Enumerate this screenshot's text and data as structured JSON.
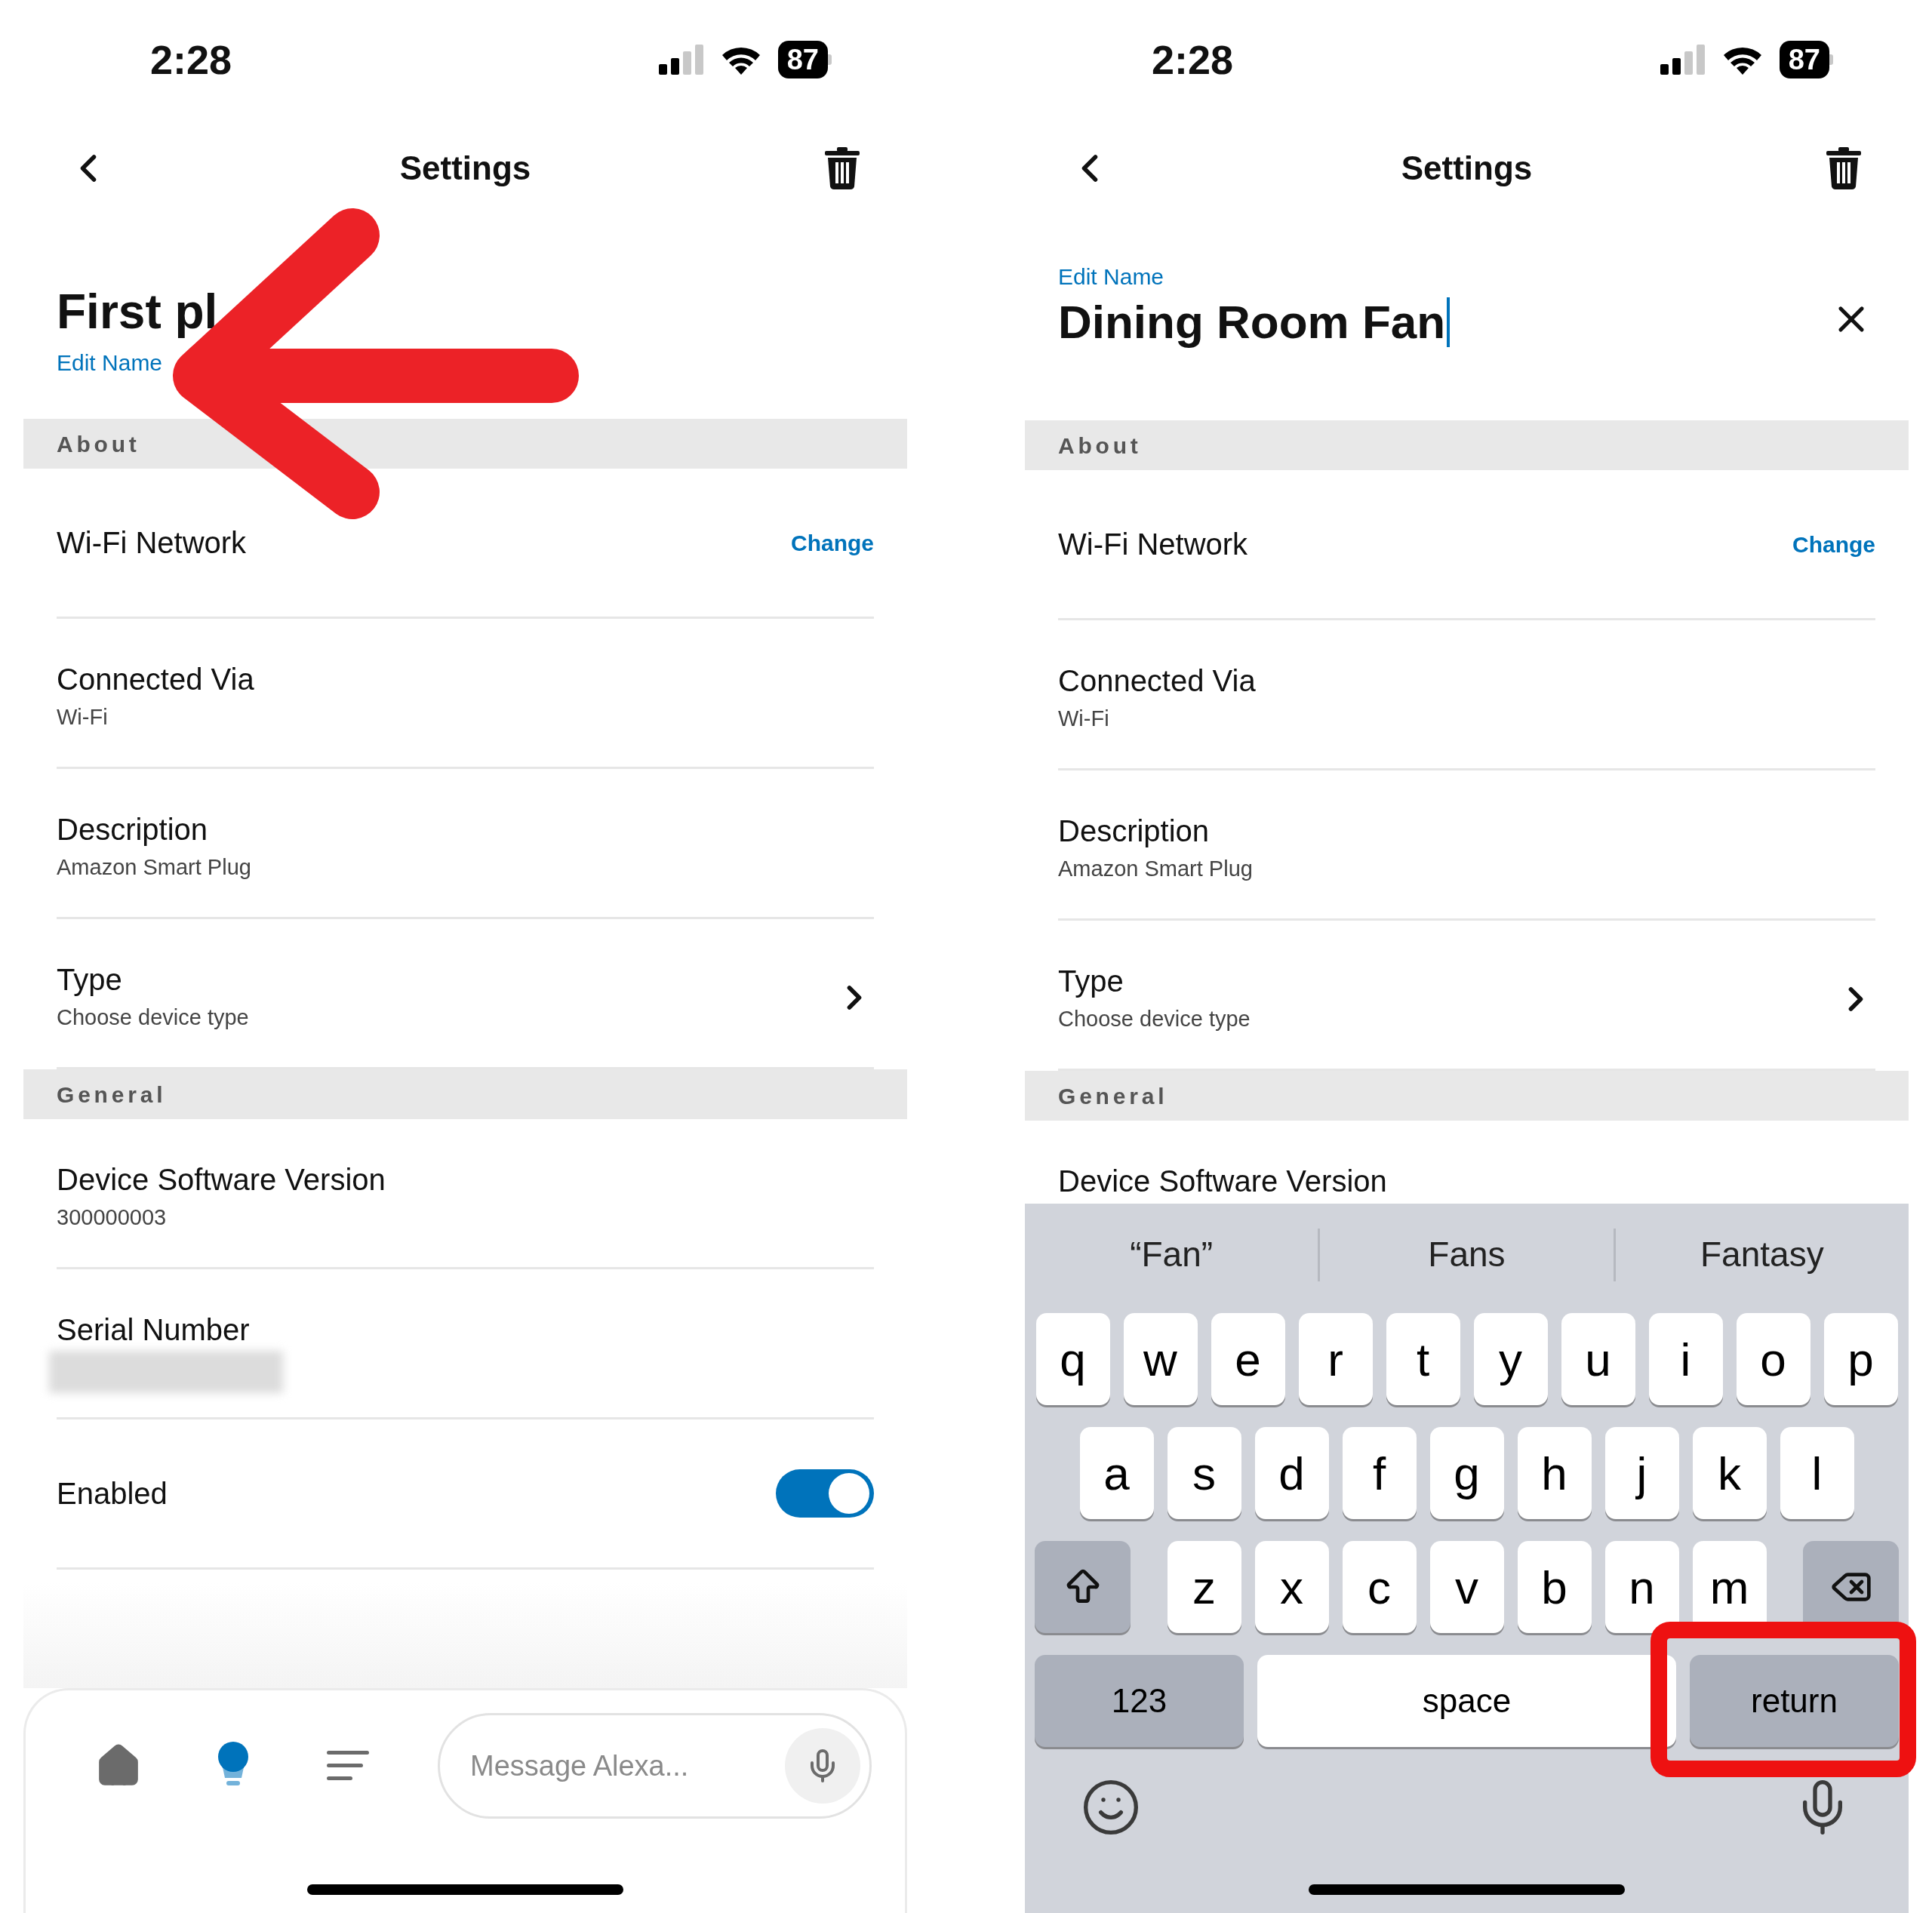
{
  "phones": [
    {
      "status_bar": {
        "time": "2:28",
        "battery": "87"
      },
      "title": "Settings",
      "arrow_annotation": true,
      "name_block": {
        "kind": "view",
        "name": "First pl",
        "edit_label": "Edit Name"
      },
      "sections": [
        {
          "heading": "About",
          "rows": [
            {
              "kind": "action",
              "label": "Wi-Fi Network",
              "action": "Change"
            },
            {
              "kind": "detail",
              "label": "Connected Via",
              "value": "Wi-Fi"
            },
            {
              "kind": "detail",
              "label": "Description",
              "value": "Amazon Smart Plug"
            },
            {
              "kind": "link",
              "label": "Type",
              "value": "Choose device type"
            }
          ]
        },
        {
          "heading": "General",
          "rows": [
            {
              "kind": "detail",
              "label": "Device Software Version",
              "value": "300000003"
            },
            {
              "kind": "redacted",
              "label": "Serial Number"
            },
            {
              "kind": "toggle",
              "label": "Enabled",
              "on": true
            }
          ]
        }
      ],
      "bottom_nav": {
        "items": [
          {
            "kind": "home",
            "selected": false
          },
          {
            "kind": "devices",
            "selected": true
          },
          {
            "kind": "more",
            "selected": false
          }
        ],
        "placeholder": "Message Alexa..."
      }
    },
    {
      "status_bar": {
        "time": "2:28",
        "battery": "87"
      },
      "title": "Settings",
      "name_block": {
        "kind": "edit",
        "name": "Dining Room Fan",
        "edit_label": "Edit Name"
      },
      "sections": [
        {
          "heading": "About",
          "rows": [
            {
              "kind": "action",
              "label": "Wi-Fi Network",
              "action": "Change"
            },
            {
              "kind": "detail",
              "label": "Connected Via",
              "value": "Wi-Fi"
            },
            {
              "kind": "detail",
              "label": "Description",
              "value": "Amazon Smart Plug"
            },
            {
              "kind": "link",
              "label": "Type",
              "value": "Choose device type"
            }
          ]
        },
        {
          "heading": "General",
          "rows": [
            {
              "kind": "detail",
              "label": "Device Software Version"
            }
          ]
        }
      ],
      "keyboard": {
        "suggestions": [
          "“Fan”",
          "Fans",
          "Fantasy"
        ],
        "rows": [
          [
            "q",
            "w",
            "e",
            "r",
            "t",
            "y",
            "u",
            "i",
            "o",
            "p"
          ],
          [
            "a",
            "s",
            "d",
            "f",
            "g",
            "h",
            "j",
            "k",
            "l"
          ],
          [
            "z",
            "x",
            "c",
            "v",
            "b",
            "n",
            "m"
          ]
        ],
        "bottom_row": [
          {
            "kind": "numbers",
            "label": "123",
            "highlighted": false
          },
          {
            "kind": "space",
            "label": "space",
            "highlighted": false
          },
          {
            "kind": "return",
            "label": "return",
            "highlighted": true
          }
        ]
      }
    }
  ]
}
